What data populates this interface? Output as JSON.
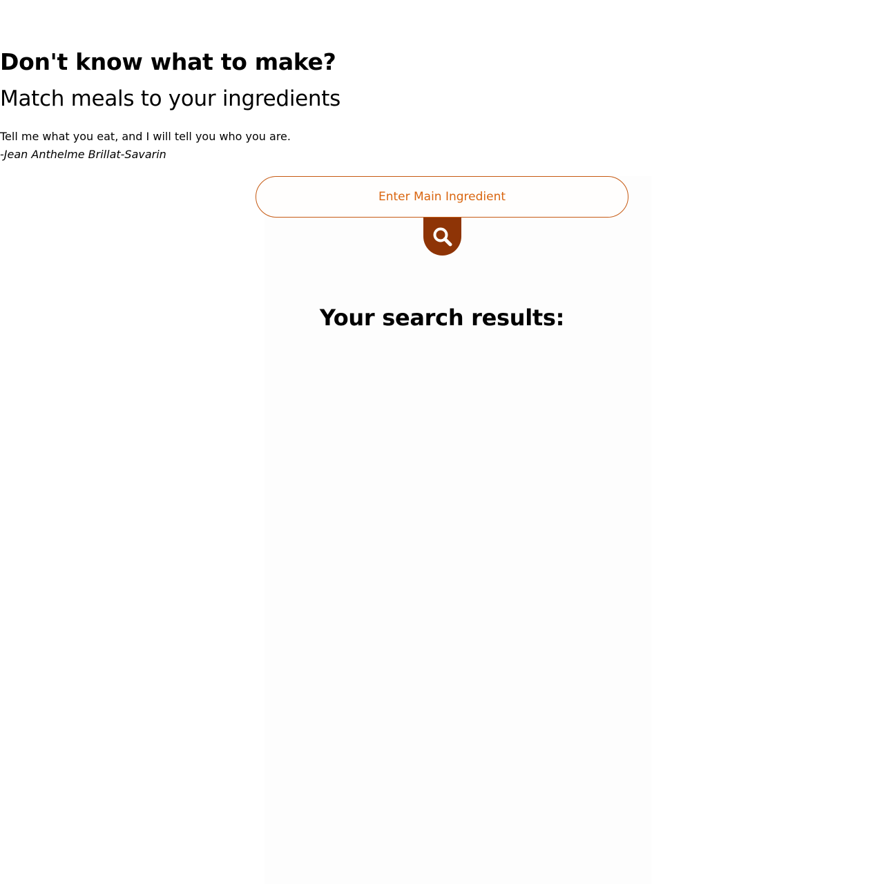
{
  "header": {
    "title": "Don't know what to make?",
    "subtitle": "Match meals to your ingredients"
  },
  "quote": {
    "text": "Tell me what you eat, and I will tell you who you are.",
    "author": "-Jean Anthelme Brillat-Savarin"
  },
  "search": {
    "placeholder": "Enter Main Ingredient",
    "value": "",
    "button_icon": "search-icon"
  },
  "results": {
    "heading": "Your search results:",
    "items": []
  },
  "colors": {
    "accent": "#d9650f",
    "input_border": "#c65a12",
    "button": "#8e3406",
    "text": "#000000",
    "background": "#ffffff"
  }
}
